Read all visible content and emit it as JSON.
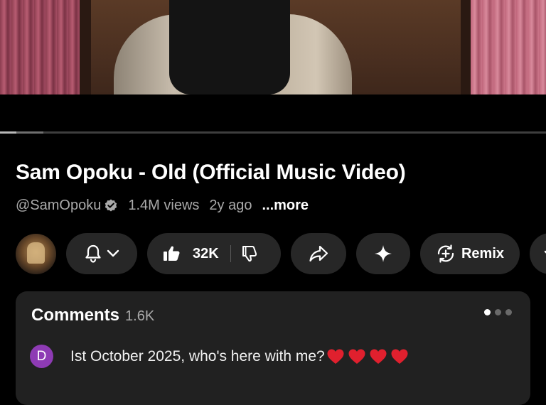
{
  "video": {
    "progress_played": 0.03,
    "progress_loaded": 0.08
  },
  "title": "Sam Opoku - Old (Official Music Video)",
  "meta": {
    "handle": "@SamOpoku",
    "views": "1.4M views",
    "ago": "2y ago",
    "more": "...more"
  },
  "actions": {
    "likes": "32K",
    "remix_label": "Remix"
  },
  "comments": {
    "title": "Comments",
    "count": "1.6K",
    "pages": 3,
    "active_page": 1,
    "top_comment": {
      "avatar_letter": "D",
      "avatar_color": "#8e3bb4",
      "text": "Ist October 2025, who's here with me?",
      "hearts": 4
    }
  },
  "colors": {
    "background": "#000000",
    "pill": "#272727",
    "card": "#212121",
    "secondary_text": "#aaaaaa",
    "heart": "#e0202e"
  },
  "icons": [
    "bell-icon",
    "chevron-down-icon",
    "thumbs-up-icon",
    "thumbs-down-icon",
    "share-icon",
    "sparkle-icon",
    "remix-icon",
    "verified-icon",
    "heart-icon"
  ]
}
